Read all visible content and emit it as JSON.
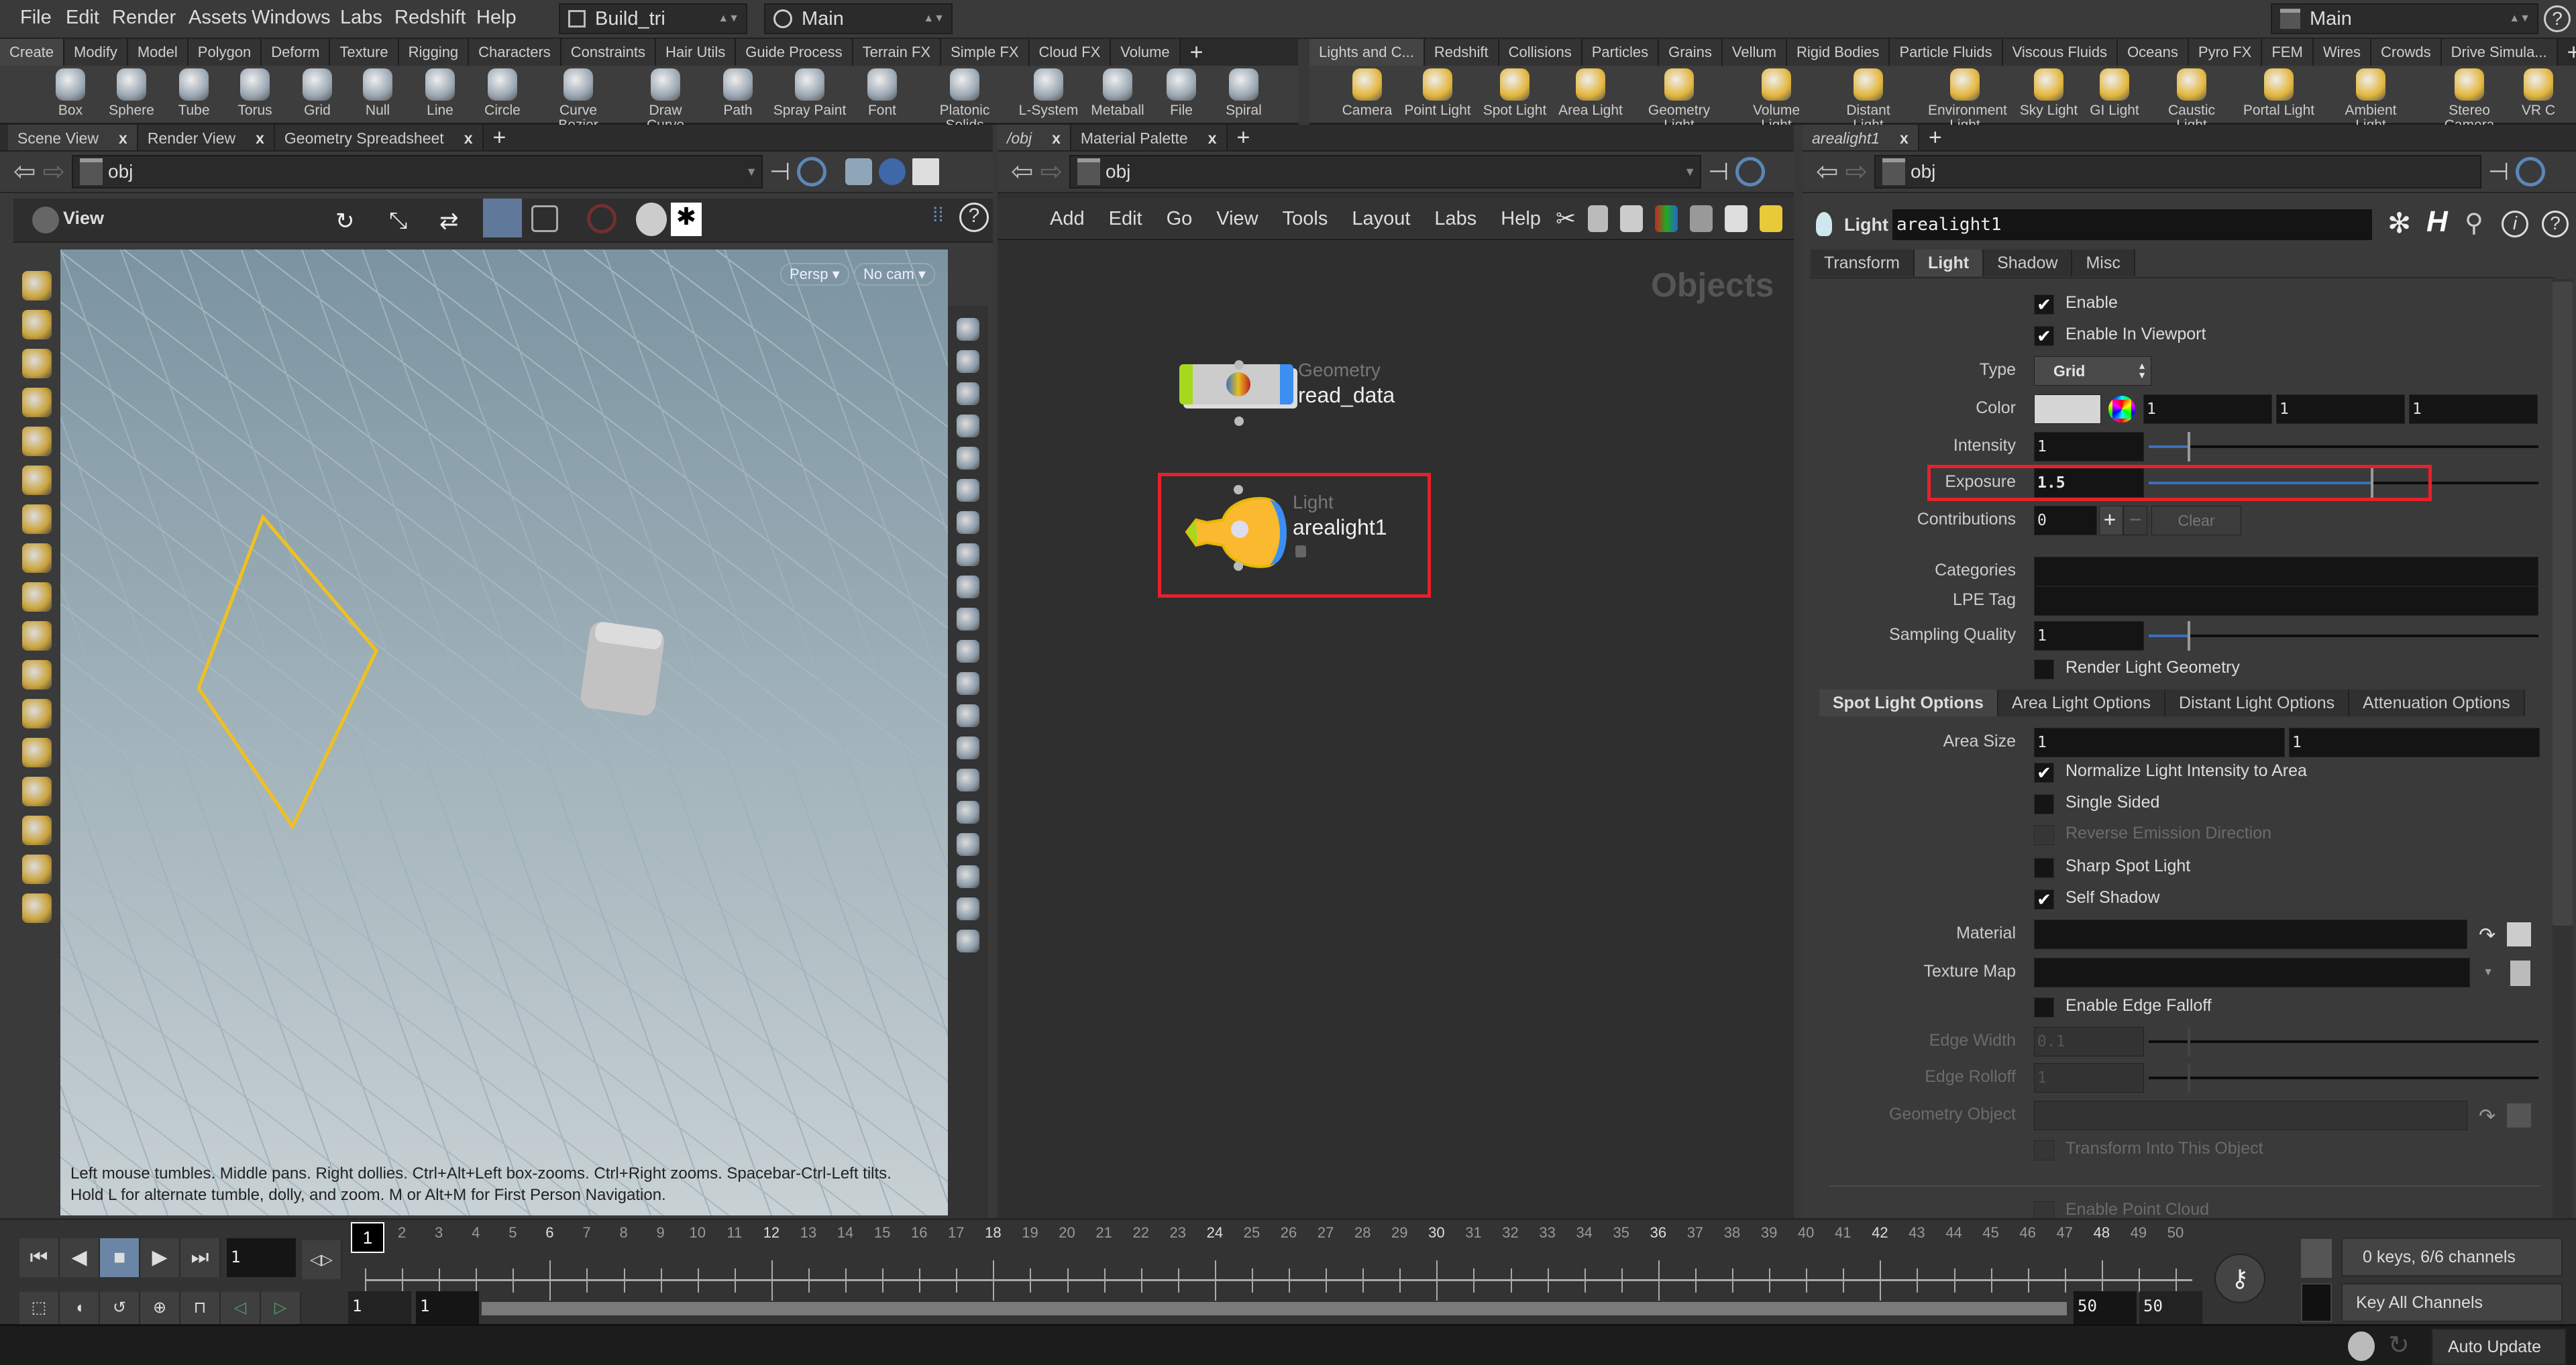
{
  "menubar": {
    "items": [
      "File",
      "Edit",
      "Render",
      "Assets",
      "Windows",
      "Labs",
      "Redshift",
      "Help"
    ],
    "desktop": "Build_tri",
    "context": "Main",
    "right_context": "Main"
  },
  "shelf_left": {
    "tabs": [
      "Create",
      "Modify",
      "Model",
      "Polygon",
      "Deform",
      "Texture",
      "Rigging",
      "Characters",
      "Constraints",
      "Hair Utils",
      "Guide Process",
      "Terrain FX",
      "Simple FX",
      "Cloud FX",
      "Volume"
    ],
    "active_tab": "Create",
    "tools": [
      {
        "label": "Box",
        "icon": "box-icon"
      },
      {
        "label": "Sphere",
        "icon": "sphere-icon"
      },
      {
        "label": "Tube",
        "icon": "tube-icon"
      },
      {
        "label": "Torus",
        "icon": "torus-icon"
      },
      {
        "label": "Grid",
        "icon": "grid-icon"
      },
      {
        "label": "Null",
        "icon": "null-icon"
      },
      {
        "label": "Line",
        "icon": "line-icon"
      },
      {
        "label": "Circle",
        "icon": "circle-icon"
      },
      {
        "label": "Curve Bezier",
        "icon": "curve-bezier-icon"
      },
      {
        "label": "Draw Curve",
        "icon": "draw-curve-icon"
      },
      {
        "label": "Path",
        "icon": "path-icon"
      },
      {
        "label": "Spray Paint",
        "icon": "spray-paint-icon"
      },
      {
        "label": "Font",
        "icon": "font-icon"
      },
      {
        "label": "Platonic Solids",
        "icon": "platonic-solids-icon"
      },
      {
        "label": "L-System",
        "icon": "l-system-icon"
      },
      {
        "label": "Metaball",
        "icon": "metaball-icon"
      },
      {
        "label": "File",
        "icon": "file-icon"
      },
      {
        "label": "Spiral",
        "icon": "spiral-icon"
      }
    ]
  },
  "shelf_right": {
    "tabs": [
      "Lights and C...",
      "Redshift",
      "Collisions",
      "Particles",
      "Grains",
      "Vellum",
      "Rigid Bodies",
      "Particle Fluids",
      "Viscous Fluids",
      "Oceans",
      "Pyro FX",
      "FEM",
      "Wires",
      "Crowds",
      "Drive Simula..."
    ],
    "active_tab": "Lights and C...",
    "tools": [
      {
        "label": "Camera",
        "icon": "camera-icon"
      },
      {
        "label": "Point Light",
        "icon": "point-light-icon"
      },
      {
        "label": "Spot Light",
        "icon": "spot-light-icon"
      },
      {
        "label": "Area Light",
        "icon": "area-light-icon"
      },
      {
        "label": "Geometry Light",
        "icon": "geometry-light-icon"
      },
      {
        "label": "Volume Light",
        "icon": "volume-light-icon"
      },
      {
        "label": "Distant Light",
        "icon": "distant-light-icon"
      },
      {
        "label": "Environment Light",
        "icon": "environment-light-icon"
      },
      {
        "label": "Sky Light",
        "icon": "sky-light-icon"
      },
      {
        "label": "GI Light",
        "icon": "gi-light-icon"
      },
      {
        "label": "Caustic Light",
        "icon": "caustic-light-icon"
      },
      {
        "label": "Portal Light",
        "icon": "portal-light-icon"
      },
      {
        "label": "Ambient Light",
        "icon": "ambient-light-icon"
      },
      {
        "label": "Stereo Camera",
        "icon": "stereo-camera-icon"
      },
      {
        "label": "VR C",
        "icon": "vr-camera-icon"
      }
    ]
  },
  "scene_pane": {
    "tabs": [
      "Scene View",
      "Render View",
      "Geometry Spreadsheet"
    ],
    "path": "obj",
    "toolbar_label": "View",
    "persp_button": "Persp",
    "cam_button": "No cam",
    "help_line1": "Left mouse tumbles. Middle pans. Right dollies. Ctrl+Alt+Left box-zooms. Ctrl+Right zooms. Spacebar-Ctrl-Left tilts.",
    "help_line2": "Hold L for alternate tumble, dolly, and zoom.     M or Alt+M for First Person Navigation.",
    "left_tools": [
      "select-icon",
      "lasso-icon",
      "handle-icon",
      "pose-icon",
      "lock-icon",
      "magnet-icon",
      "paint-icon",
      "brush-icon",
      "rotate-icon",
      "scale-icon",
      "snap-icon",
      "snap-grid-icon",
      "snap-curve-icon",
      "snap-point-icon",
      "camera-icon",
      "render-icon",
      "disk-icon"
    ],
    "right_tools": [
      "display-options-icon",
      "wireframe-icon",
      "lock-icon",
      "close-icon",
      "light-icon",
      "bulb-icon",
      "shadow-icon",
      "point-icon",
      "brush-icon",
      "pen-icon",
      "number-icon",
      "eraser-icon",
      "number-icon",
      "corner-icon",
      "bevel-icon",
      "checker-icon",
      "material-icon",
      "uv-icon",
      "star-icon",
      "scroll-icon"
    ]
  },
  "network_pane": {
    "tabs": [
      "/obj",
      "Material Palette"
    ],
    "path": "obj",
    "menu": [
      "Add",
      "Edit",
      "Go",
      "View",
      "Tools",
      "Layout",
      "Labs",
      "Help"
    ],
    "context_title": "Objects",
    "nodes": [
      {
        "type": "Geometry",
        "name": "read_data"
      },
      {
        "type": "Light",
        "name": "arealight1",
        "selected": true
      }
    ],
    "highlight_color": "#e8202a"
  },
  "param_pane": {
    "tab": "arealight1",
    "path": "obj",
    "node_type_label": "Light",
    "node_name": "arealight1",
    "tabs": [
      "Transform",
      "Light",
      "Shadow",
      "Misc"
    ],
    "active_tab": "Light",
    "rows": [
      {
        "kind": "check",
        "label": "Enable",
        "checked": true
      },
      {
        "kind": "check",
        "label": "Enable In Viewport",
        "checked": true
      },
      {
        "kind": "menu",
        "label": "Type",
        "value": "Grid"
      },
      {
        "kind": "color",
        "label": "Color",
        "values": [
          "1",
          "1",
          "1"
        ],
        "swatch": "#d6d6d6"
      },
      {
        "kind": "slider",
        "label": "Intensity",
        "value": "1",
        "slider": 0.1
      },
      {
        "kind": "slider",
        "label": "Exposure",
        "value": "1.5",
        "slider": 0.57,
        "highlighted": true
      },
      {
        "kind": "contrib",
        "label": "Contributions",
        "value": "0",
        "clear": "Clear"
      },
      {
        "kind": "text",
        "label": "Categories",
        "value": ""
      },
      {
        "kind": "text",
        "label": "LPE Tag",
        "value": ""
      },
      {
        "kind": "slider",
        "label": "Sampling Quality",
        "value": "1",
        "slider": 0.1
      },
      {
        "kind": "check",
        "label": "Render Light Geometry",
        "checked": false
      }
    ],
    "subtabs": [
      "Spot Light Options",
      "Area Light Options",
      "Distant Light Options",
      "Attenuation Options"
    ],
    "active_subtab": "Spot Light Options",
    "subrows": [
      {
        "kind": "vec",
        "label": "Area Size",
        "values": [
          "1",
          "1"
        ]
      },
      {
        "kind": "check",
        "label": "Normalize Light Intensity to Area",
        "checked": true
      },
      {
        "kind": "check",
        "label": "Single Sided",
        "checked": false
      },
      {
        "kind": "check",
        "label": "Reverse Emission Direction",
        "checked": false,
        "disabled": true
      },
      {
        "kind": "check",
        "label": "Sharp Spot Light",
        "checked": false
      },
      {
        "kind": "check",
        "label": "Self Shadow",
        "checked": true
      },
      {
        "kind": "path",
        "label": "Material",
        "value": ""
      },
      {
        "kind": "file",
        "label": "Texture Map",
        "value": ""
      },
      {
        "kind": "check",
        "label": "Enable Edge Falloff",
        "checked": false
      },
      {
        "kind": "slider",
        "label": "Edge Width",
        "value": "0.1",
        "slider": 0.1,
        "disabled": true
      },
      {
        "kind": "slider",
        "label": "Edge Rolloff",
        "value": "1",
        "slider": 0.1,
        "disabled": true
      },
      {
        "kind": "path",
        "label": "Geometry Object",
        "value": "",
        "disabled": true
      },
      {
        "kind": "check",
        "label": "Transform Into This Object",
        "checked": false,
        "disabled": true
      },
      {
        "kind": "check",
        "label": "Enable Point Cloud",
        "checked": false,
        "disabled": true
      }
    ]
  },
  "timeline": {
    "current_frame": "1",
    "frame_start": 1,
    "frame_end": 50,
    "range_start": "1",
    "range_start2": "1",
    "range_end": "50",
    "range_end2": "50",
    "keys_status": "0 keys, 6/6 channels",
    "key_mode": "Key All Channels"
  },
  "statusbar": {
    "update_mode": "Auto Update"
  }
}
